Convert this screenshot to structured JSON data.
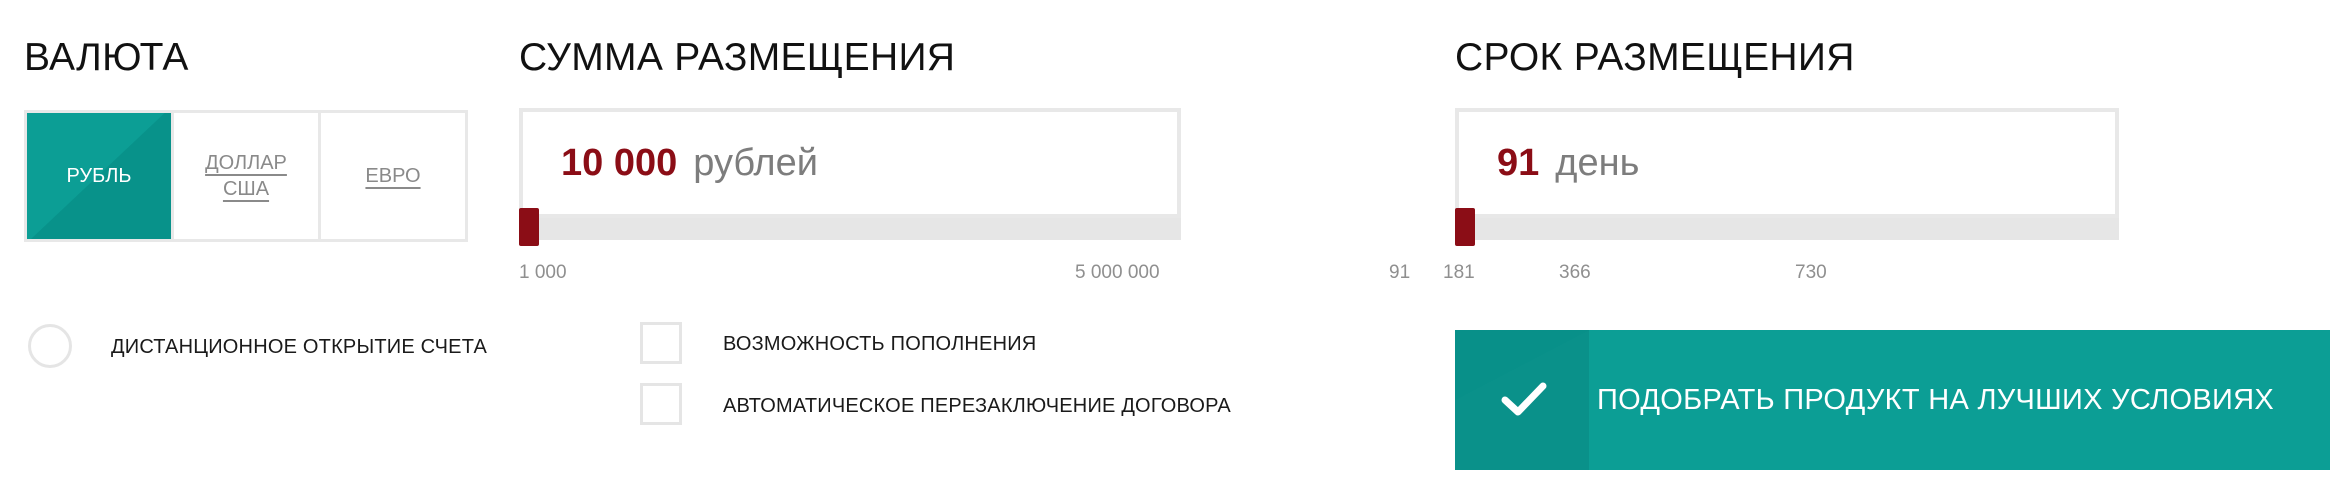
{
  "currency": {
    "title": "ВАЛЮТА",
    "options": [
      {
        "label": "РУБЛЬ",
        "active": true
      },
      {
        "label": "ДОЛЛАР\nСША",
        "active": false
      },
      {
        "label": "ЕВРО",
        "active": false
      }
    ]
  },
  "amount": {
    "title": "СУММА РАЗМЕЩЕНИЯ",
    "value": "10 000",
    "unit": "рублей",
    "min_label": "1 000",
    "max_label": "5 000 000",
    "slider_fraction": 0.0
  },
  "term": {
    "title": "СРОК РАЗМЕЩЕНИЯ",
    "value": "91",
    "unit": "день",
    "ticks": [
      "91",
      "181",
      "366",
      "730"
    ],
    "slider_fraction": 0.0
  },
  "options": {
    "remote_opening": "ДИСТАНЦИОННОЕ ОТКРЫТИЕ СЧЕТА",
    "replenishment": "ВОЗМОЖНОСТЬ ПОПОЛНЕНИЯ",
    "auto_renewal": "АВТОМАТИЧЕСКОЕ ПЕРЕЗАКЛЮЧЕНИЕ ДОГОВОРА"
  },
  "cta": {
    "label": "ПОДОБРАТЬ ПРОДУКТ НА ЛУЧШИХ УСЛОВИЯХ",
    "icon": "checkmark-icon"
  },
  "colors": {
    "accent": "#0c9e95",
    "value": "#8b0d16"
  }
}
